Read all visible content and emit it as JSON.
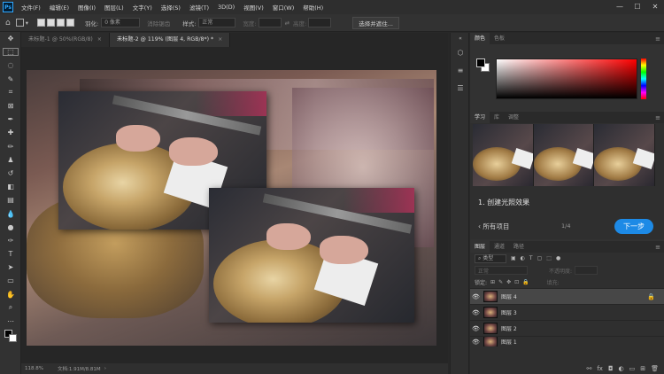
{
  "app": {
    "logo": "Ps"
  },
  "menubar": {
    "items": [
      "文件(F)",
      "编辑(E)",
      "图像(I)",
      "图层(L)",
      "文字(Y)",
      "选择(S)",
      "滤镜(T)",
      "3D(D)",
      "视图(V)",
      "窗口(W)",
      "帮助(H)"
    ],
    "window_controls": {
      "minimize": "—",
      "maximize": "☐",
      "close": "✕"
    }
  },
  "options_bar": {
    "feather_label": "羽化:",
    "feather_value": "0 像素",
    "antialias_label": "消除锯齿",
    "style_label": "样式:",
    "style_value": "正常",
    "width_label": "宽度:",
    "height_label": "高度:",
    "select_mask_button": "选择并遮住..."
  },
  "tabs": [
    {
      "label": "未标题-1 @ 50%(RGB/8)",
      "close": "×"
    },
    {
      "label": "未标题-2 @ 119% (图层 4, RGB/8*) *",
      "close": "×"
    }
  ],
  "statusbar": {
    "zoom": "118.8%",
    "doc_info": "文档:1.91M/8.81M"
  },
  "color_panel": {
    "tabs": [
      "颜色",
      "色板"
    ],
    "fg_color": "#000000",
    "bg_color": "#ffffff"
  },
  "learn_panel": {
    "tabs": [
      "学习",
      "库",
      "调整"
    ],
    "lesson_title": "1. 创建光照效果",
    "back_label": "所有项目",
    "step": "1/4",
    "next_button": "下一步"
  },
  "layers_panel": {
    "tabs": [
      "图层",
      "通道",
      "路径"
    ],
    "filter_kind": "类型",
    "mode_value": "正常",
    "opacity_label": "不透明度:",
    "lock_label": "锁定:",
    "fill_label": "填充:",
    "layers": [
      {
        "name": "图层 4",
        "selected": true,
        "locked": true
      },
      {
        "name": "图层 3",
        "selected": false,
        "locked": false
      },
      {
        "name": "图层 2",
        "selected": false,
        "locked": false
      },
      {
        "name": "图层 1",
        "selected": false,
        "locked": false
      }
    ]
  },
  "colors": {
    "accent": "#1d8ae6",
    "panel_bg": "#323232",
    "app_bg": "#282828"
  }
}
